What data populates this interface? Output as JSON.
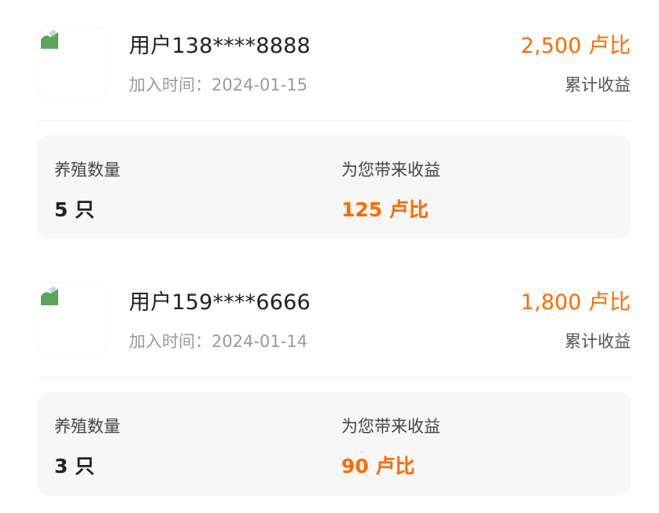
{
  "members": [
    {
      "name": "用户138****8888",
      "join_text": "加入时间：2024-01-15",
      "total_earnings": "2,500 卢比",
      "total_earnings_label": "累计收益",
      "stats": {
        "breeding_label": "养殖数量",
        "breeding_value": "5 只",
        "earnings_label": "为您带来收益",
        "earnings_value": "125 卢比"
      }
    },
    {
      "name": "用户159****6666",
      "join_text": "加入时间：2024-01-14",
      "total_earnings": "1,800 卢比",
      "total_earnings_label": "累计收益",
      "stats": {
        "breeding_label": "养殖数量",
        "breeding_value": "3 只",
        "earnings_label": "为您带来收益",
        "earnings_value": "90 卢比"
      }
    }
  ],
  "colors": {
    "accent": "#ff6a00",
    "text_primary": "#222222",
    "text_secondary": "#9a9a9a",
    "panel_bg": "#f7f7f8"
  },
  "icons": {
    "avatar_placeholder": "broken-image-icon"
  }
}
